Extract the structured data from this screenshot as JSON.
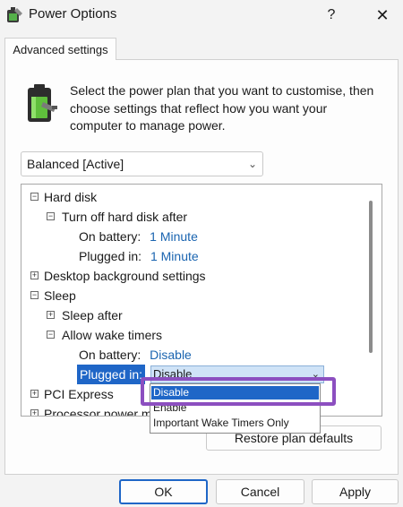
{
  "window": {
    "title": "Power Options",
    "help": "?",
    "close": "✕"
  },
  "tab": {
    "label": "Advanced settings"
  },
  "description": "Select the power plan that you want to customise, then choose settings that reflect how you want your computer to manage power.",
  "plan_select": {
    "value": "Balanced [Active]"
  },
  "tree": {
    "hard_disk": "Hard disk",
    "turn_off_hard_disk": "Turn off hard disk after",
    "hd_on_battery_label": "On battery:",
    "hd_on_battery_value": "1 Minute",
    "hd_plugged_label": "Plugged in:",
    "hd_plugged_value": "1 Minute",
    "desktop_bg": "Desktop background settings",
    "sleep": "Sleep",
    "sleep_after": "Sleep after",
    "allow_wake_timers": "Allow wake timers",
    "wt_on_battery_label": "On battery:",
    "wt_on_battery_value": "Disable",
    "wt_plugged_label": "Plugged in:",
    "wt_plugged_value": "Disable",
    "pci_express": "PCI Express",
    "processor_power": "Processor power m"
  },
  "dropdown": {
    "options": [
      "Disable",
      "Enable",
      "Important Wake Timers Only"
    ],
    "selected": "Disable"
  },
  "buttons": {
    "restore": "Restore plan defaults",
    "ok": "OK",
    "cancel": "Cancel",
    "apply": "Apply"
  },
  "colors": {
    "accent": "#1f66c7",
    "link": "#1a64b0",
    "highlight_box": "#8c4fc0"
  }
}
